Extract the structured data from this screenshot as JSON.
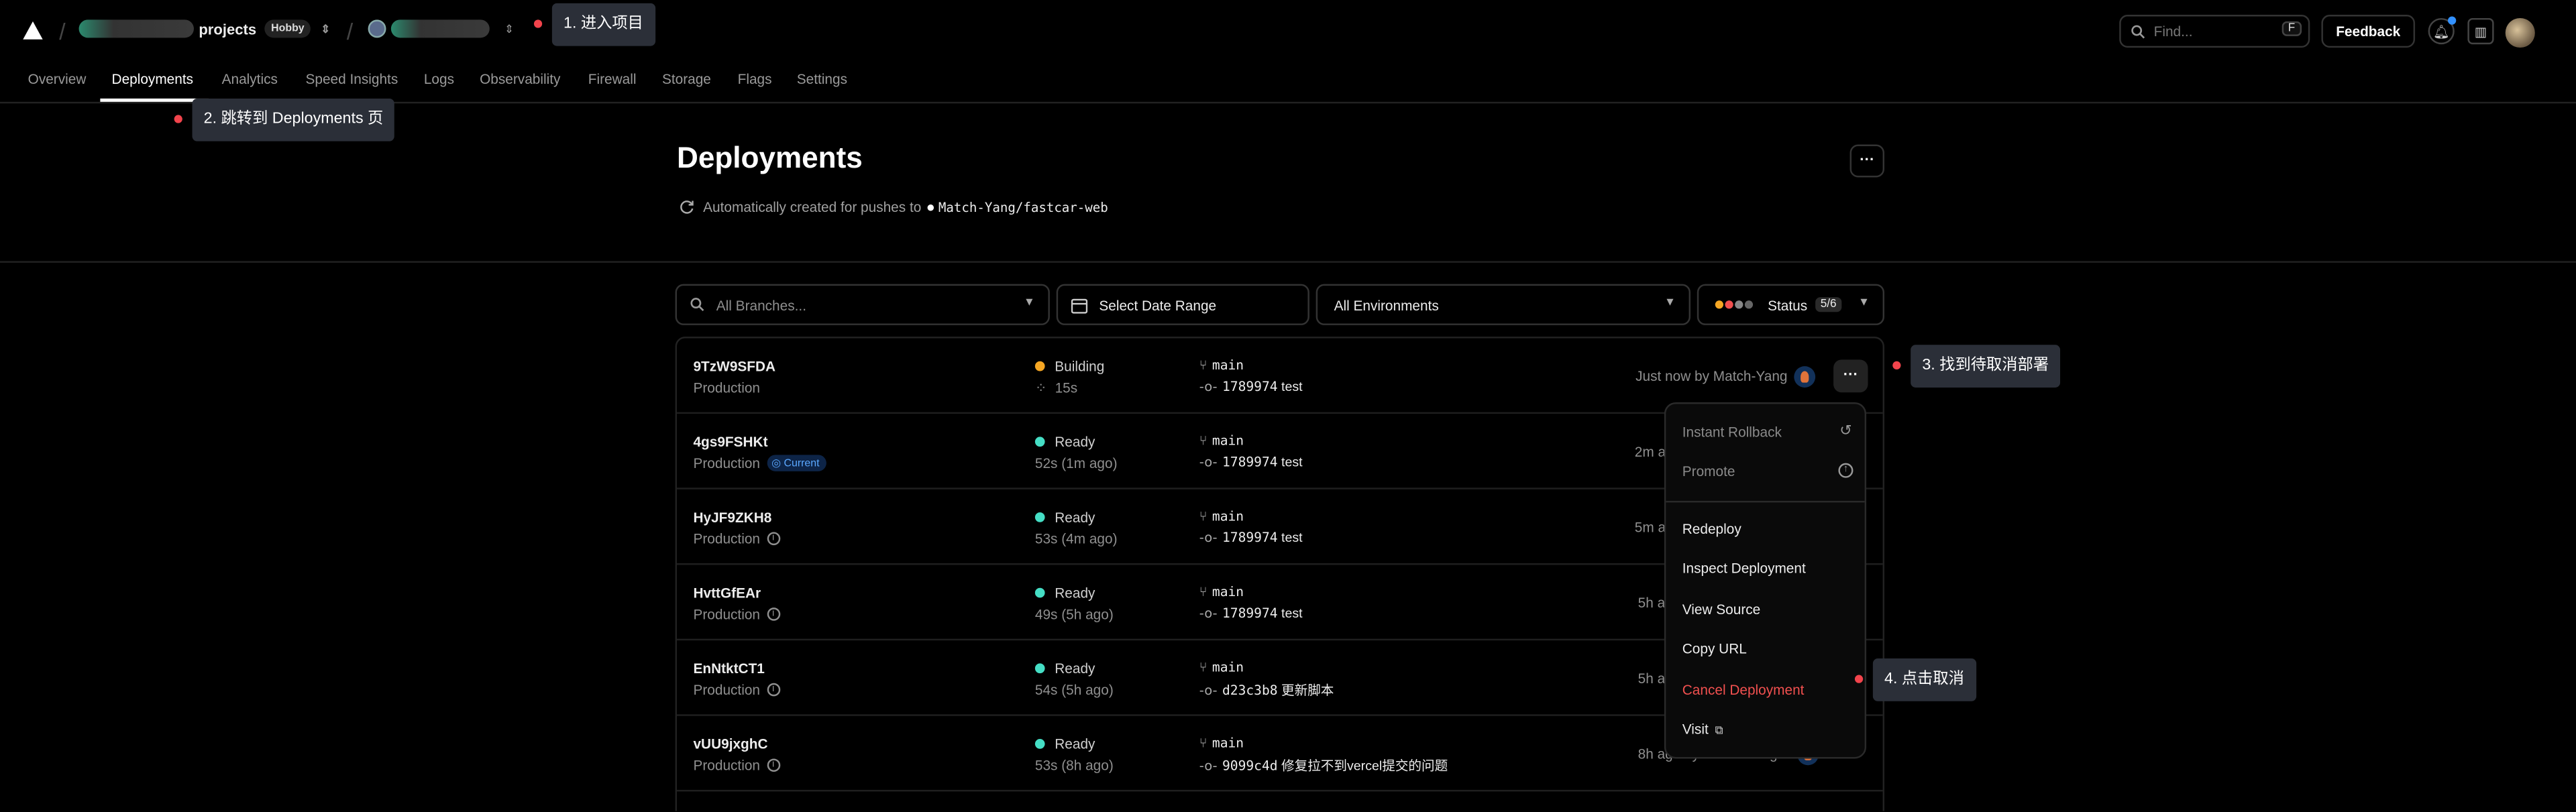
{
  "topbar": {
    "team_name": "projects",
    "plan_badge": "Hobby",
    "find_placeholder": "Find...",
    "find_shortcut": "F",
    "feedback_label": "Feedback"
  },
  "tabs": [
    "Overview",
    "Deployments",
    "Analytics",
    "Speed Insights",
    "Logs",
    "Observability",
    "Firewall",
    "Storage",
    "Flags",
    "Settings"
  ],
  "header": {
    "title": "Deployments",
    "auto_text": "Automatically created for pushes to",
    "repo": "Match-Yang/fastcar-web"
  },
  "filters": {
    "branch_placeholder": "All Branches...",
    "date_label": "Select Date Range",
    "env_label": "All Environments",
    "status_label": "Status",
    "status_count": "5/6"
  },
  "deployments": [
    {
      "id": "9TzW9SFDA",
      "env": "Production",
      "status": "Building",
      "status_color": "#f5a623",
      "duration": "15s",
      "branch": "main",
      "hash": "1789974",
      "message": "test",
      "meta": "Just now by Match-Yang"
    },
    {
      "id": "4gs9FSHKt",
      "env": "Production",
      "current": "Current",
      "status": "Ready",
      "status_color": "#45dec5",
      "duration": "52s (1m ago)",
      "branch": "main",
      "hash": "1789974",
      "message": "test",
      "meta": "2m a"
    },
    {
      "id": "HyJF9ZKH8",
      "env": "Production",
      "status": "Ready",
      "status_color": "#45dec5",
      "duration": "53s (4m ago)",
      "branch": "main",
      "hash": "1789974",
      "message": "test",
      "meta": "5m a"
    },
    {
      "id": "HvttGfEAr",
      "env": "Production",
      "status": "Ready",
      "status_color": "#45dec5",
      "duration": "49s (5h ago)",
      "branch": "main",
      "hash": "1789974",
      "message": "test",
      "meta": "5h a"
    },
    {
      "id": "EnNtktCT1",
      "env": "Production",
      "status": "Ready",
      "status_color": "#45dec5",
      "duration": "54s (5h ago)",
      "branch": "main",
      "hash": "d23c3b8",
      "message": "更新脚本",
      "meta": "5h a"
    },
    {
      "id": "vUU9jxghC",
      "env": "Production",
      "status": "Ready",
      "status_color": "#45dec5",
      "duration": "53s (8h ago)",
      "branch": "main",
      "hash": "9099c4d",
      "message": "修复拉不到vercel提交的问题",
      "meta": "8h ago by Match-Yang"
    }
  ],
  "menu": {
    "instant_rollback": "Instant Rollback",
    "promote": "Promote",
    "redeploy": "Redeploy",
    "inspect": "Inspect Deployment",
    "view_source": "View Source",
    "copy_url": "Copy URL",
    "cancel": "Cancel Deployment",
    "visit": "Visit"
  },
  "annotations": {
    "step1": "1. 进入项目",
    "step2": "2. 跳转到 Deployments 页",
    "step3": "3. 找到待取消部署",
    "step4": "4. 点击取消"
  }
}
